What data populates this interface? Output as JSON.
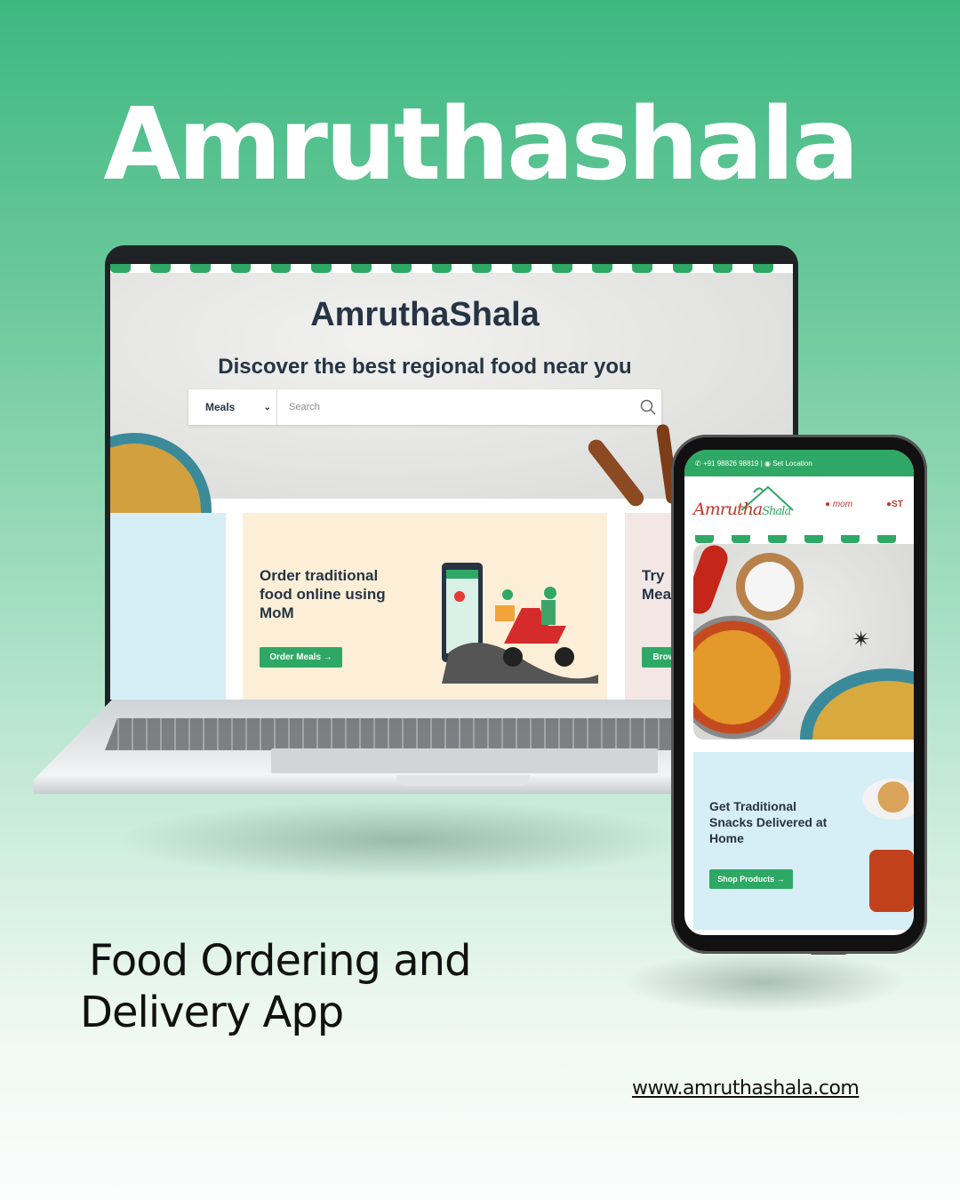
{
  "hero": {
    "title": "Amruthashala"
  },
  "tagline": {
    "line1": "Food Ordering and",
    "line2": "Delivery App"
  },
  "website": "www.amruthashala.com",
  "colors": {
    "brand_green": "#2fa865",
    "heading_navy": "#263444",
    "card_cream": "#fdefd7",
    "card_blue": "#d6eef6"
  },
  "laptop": {
    "brand": "AmruthaShala",
    "headline": "Discover the best regional food near you",
    "search": {
      "category": "Meals",
      "placeholder": "Search",
      "icon": "search-icon"
    },
    "cards": [
      {
        "title": "Order traditional food online using MoM",
        "button": "Order Meals"
      },
      {
        "title": "Try",
        "title_line2": "Mea",
        "button": "Brow"
      }
    ]
  },
  "phone": {
    "topbar": {
      "phone": "+91 98826 98819",
      "separator": "|",
      "location": "Set Location"
    },
    "logo": {
      "main": "Amrutha",
      "sub": "Shala"
    },
    "partner_logos": [
      "mom",
      "ST"
    ],
    "card": {
      "title": "Get Traditional Snacks Delivered at Home",
      "button": "Shop Products"
    }
  }
}
